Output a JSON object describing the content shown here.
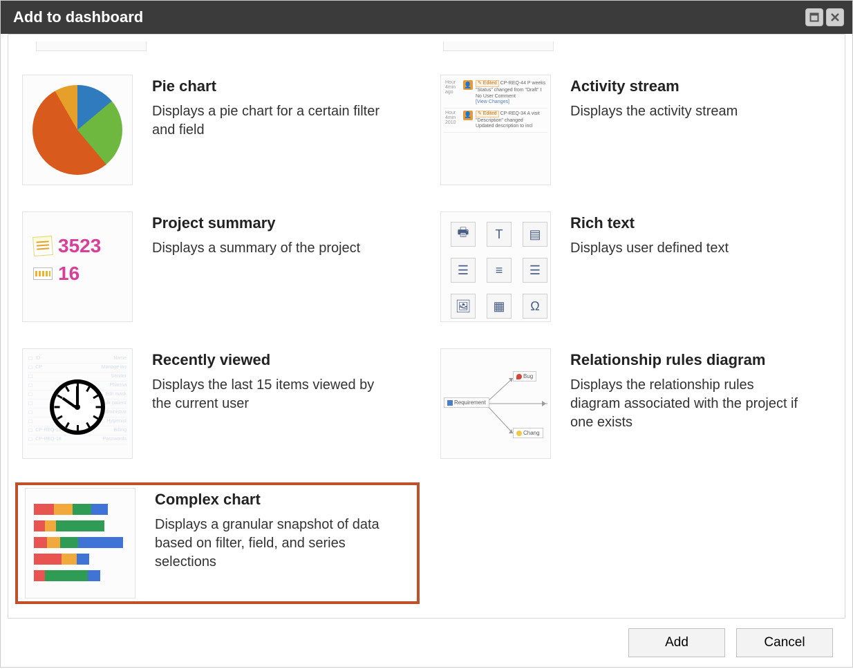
{
  "dialog": {
    "title": "Add to dashboard"
  },
  "widgets": {
    "pie_chart": {
      "title": "Pie chart",
      "desc": "Displays a pie chart for a certain filter and field"
    },
    "activity_stream": {
      "title": "Activity stream",
      "desc": "Displays the activity stream"
    },
    "project_summary": {
      "title": "Project summary",
      "desc": "Displays a summary of the project",
      "sample_numbers": {
        "a": "3523",
        "b": "16"
      }
    },
    "rich_text": {
      "title": "Rich text",
      "desc": "Displays user defined text"
    },
    "recently_viewed": {
      "title": "Recently viewed",
      "desc": "Displays the last 15 items viewed by the current user"
    },
    "relationship_rules": {
      "title": "Relationship rules diagram",
      "desc": "Displays the relationship rules diagram associated with the project if one exists",
      "nodes": {
        "req": "Requirement",
        "bug": "Bug",
        "chg": "Chang"
      }
    },
    "complex_chart": {
      "title": "Complex chart",
      "desc": "Displays a granular snapshot of data based on filter, field, and series selections"
    }
  },
  "selected_widget": "complex_chart",
  "footer": {
    "add": "Add",
    "cancel": "Cancel"
  }
}
